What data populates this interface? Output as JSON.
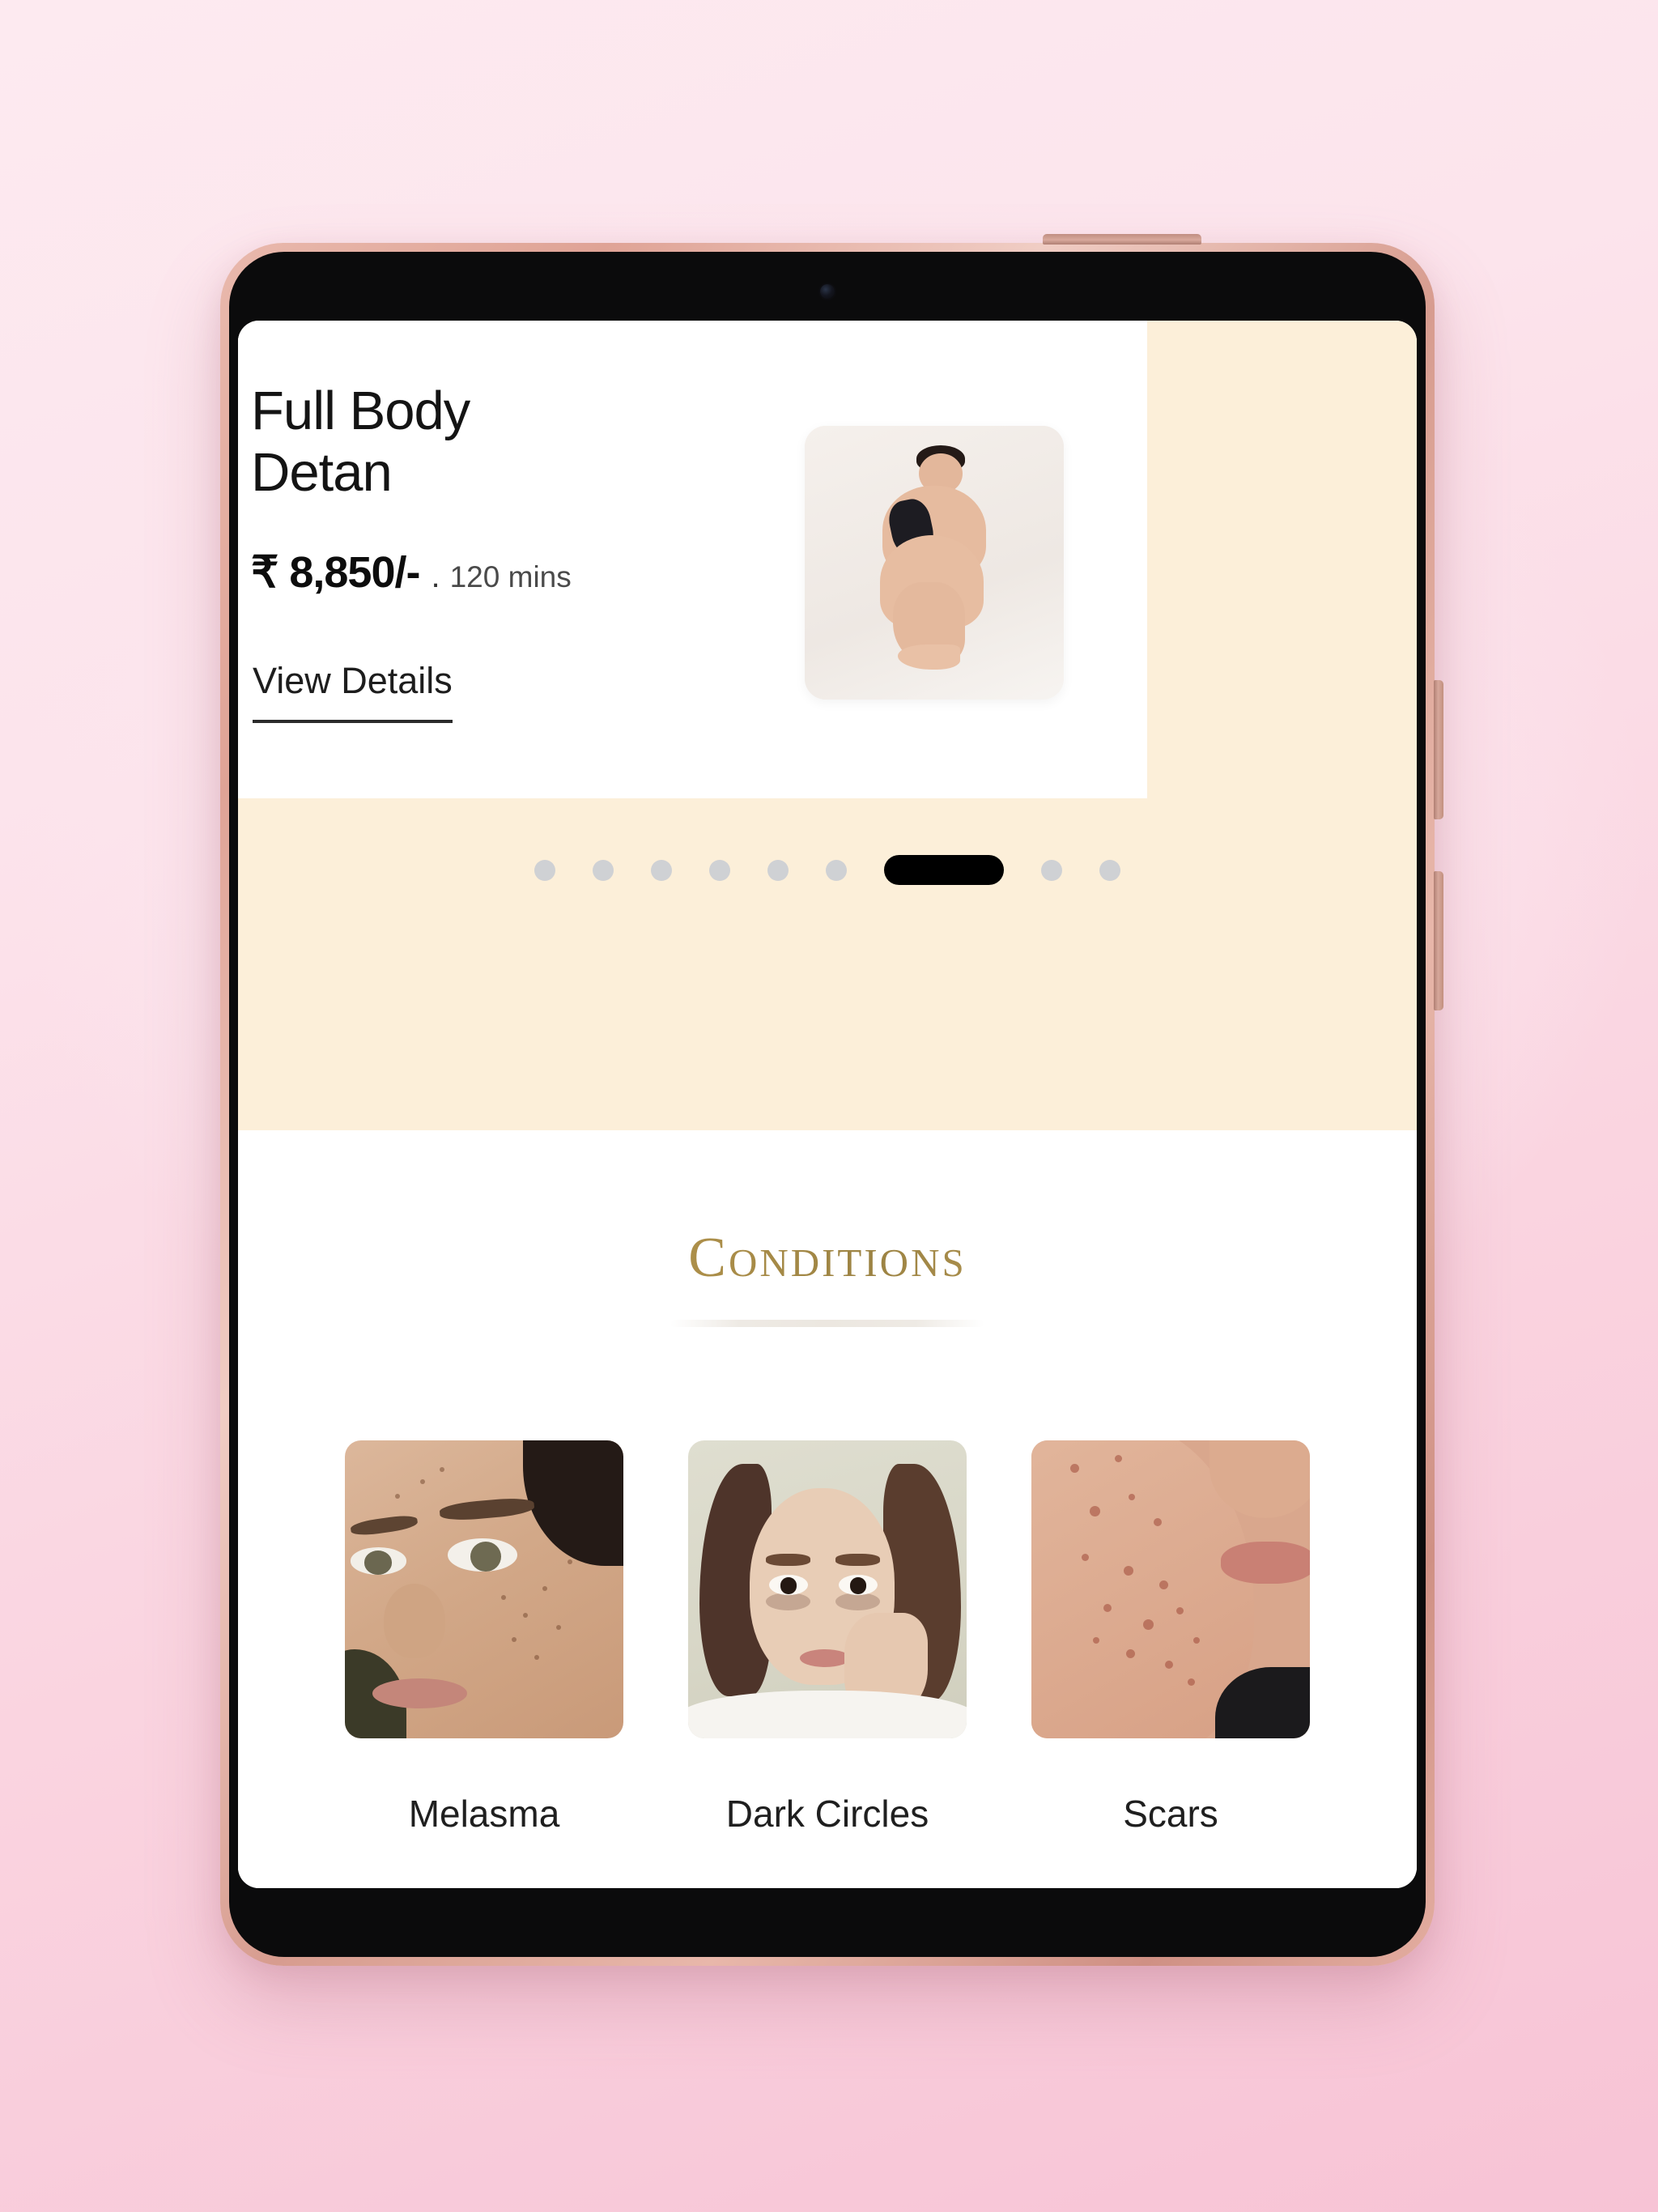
{
  "device": {
    "type": "tablet",
    "frame_color": "#dfa396",
    "bezel_color": "#0b0b0c",
    "camera_icon": "front-camera-icon",
    "buttons": [
      {
        "name": "power-button",
        "edge": "top"
      },
      {
        "name": "volume-up-button",
        "edge": "right"
      },
      {
        "name": "volume-down-button",
        "edge": "right"
      }
    ]
  },
  "background": {
    "gradient_from": "#fdeaf0",
    "gradient_to": "#f7c3d5"
  },
  "app": {
    "accent_cream": "#fcefd9",
    "accent_gold": "#9c8343",
    "service_card": {
      "title": "Full Body\nDetan",
      "title_line1": "Full Body",
      "title_line2": "Detan",
      "price": "₹ 8,850/-",
      "separator": ".",
      "duration": "120 mins",
      "view_details_label": "View Details",
      "thumbnail_alt": "full-body-detan-photo"
    },
    "carousel": {
      "total": 9,
      "active_index": 7,
      "dots": [
        {
          "index": 1,
          "active": false
        },
        {
          "index": 2,
          "active": false
        },
        {
          "index": 3,
          "active": false
        },
        {
          "index": 4,
          "active": false
        },
        {
          "index": 5,
          "active": false
        },
        {
          "index": 6,
          "active": false
        },
        {
          "index": 7,
          "active": true
        },
        {
          "index": 8,
          "active": false
        },
        {
          "index": 9,
          "active": false
        }
      ]
    },
    "conditions": {
      "heading": "Conditions",
      "items": [
        {
          "label": "Melasma",
          "image_alt": "melasma-face-photo"
        },
        {
          "label": "Dark Circles",
          "image_alt": "dark-circles-face-photo"
        },
        {
          "label": "Scars",
          "image_alt": "acne-scars-cheek-photo"
        }
      ]
    }
  }
}
